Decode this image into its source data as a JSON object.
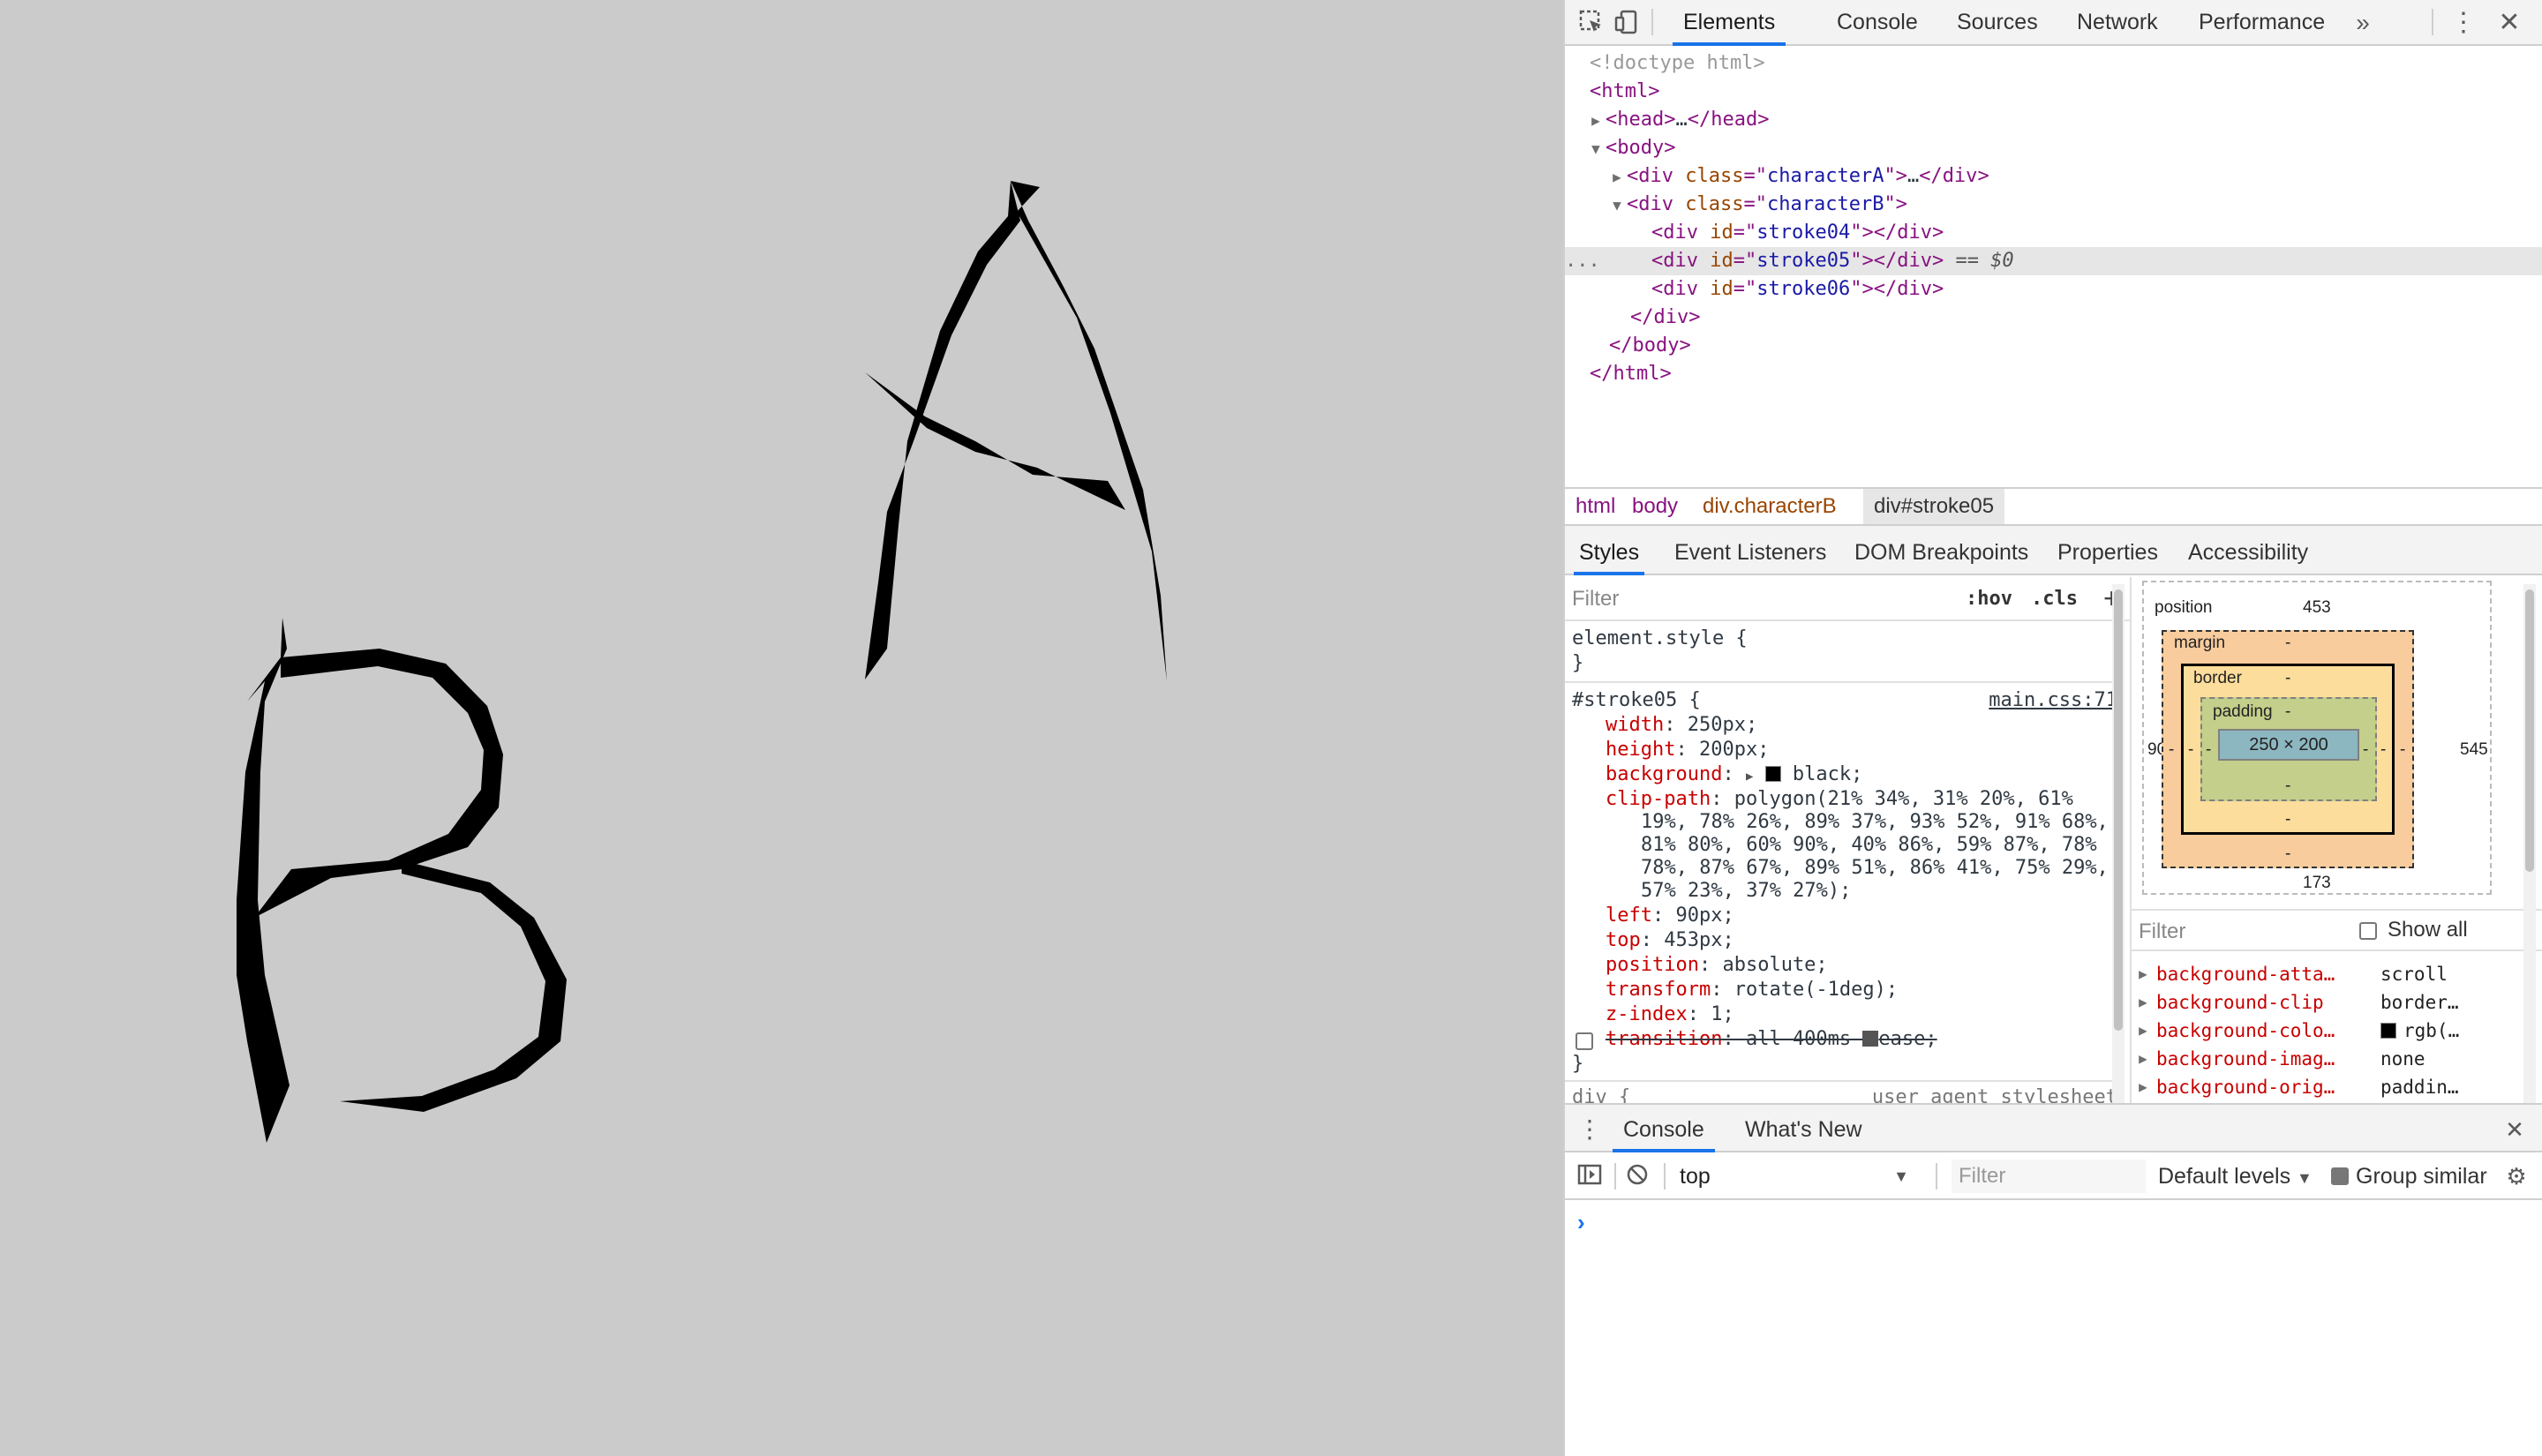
{
  "viewport": {
    "background": "#cbcbcb",
    "letters": [
      "A",
      "B"
    ]
  },
  "devtools": {
    "main_tabs": [
      "Elements",
      "Console",
      "Sources",
      "Network",
      "Performance"
    ],
    "more_tabs_icon": "chevrons-right-icon",
    "dom": {
      "doctype": "<!doctype html>",
      "html_open": "html",
      "head": "head",
      "head_ellipsis": "…",
      "body": "body",
      "div": "div",
      "class_attr": "class",
      "id_attr": "id",
      "character_a": "characterA",
      "character_b": "characterB",
      "stroke04": "stroke04",
      "stroke05": "stroke05",
      "stroke06": "stroke06",
      "selected_marker": "== $0",
      "row_menu": "..."
    },
    "breadcrumbs": [
      "html",
      "body",
      "div.characterB",
      "div#stroke05"
    ],
    "sub_tabs": [
      "Styles",
      "Event Listeners",
      "DOM Breakpoints",
      "Properties",
      "Accessibility"
    ],
    "styles": {
      "filter_placeholder": "Filter",
      "hov": ":hov",
      "cls": ".cls",
      "element_style": "element.style {",
      "close_brace": "}",
      "selector": "#stroke05 {",
      "source": "main.css:71",
      "props": [
        {
          "name": "width",
          "value": "250px;"
        },
        {
          "name": "height",
          "value": "200px;"
        },
        {
          "name": "background",
          "value": "black;"
        },
        {
          "name": "clip-path",
          "value": "polygon(21% 34%, 31% 20%, 61%"
        },
        {
          "name": "",
          "value": "19%, 78% 26%, 89% 37%, 93% 52%, 91% 68%,"
        },
        {
          "name": "",
          "value": "81% 80%, 60% 90%, 40% 86%, 59% 87%, 78%"
        },
        {
          "name": "",
          "value": "78%, 87% 67%, 89% 51%, 86% 41%, 75% 29%,"
        },
        {
          "name": "",
          "value": "57% 23%, 37% 27%);"
        },
        {
          "name": "left",
          "value": "90px;"
        },
        {
          "name": "top",
          "value": "453px;"
        },
        {
          "name": "position",
          "value": "absolute;"
        },
        {
          "name": "transform",
          "value": "rotate(-1deg);"
        },
        {
          "name": "z-index",
          "value": "1;"
        },
        {
          "name": "transition",
          "value": "all 400ms ",
          "extra": "ease;"
        }
      ],
      "next_rule": "div {",
      "next_source": "user agent stylesheet"
    },
    "box_model": {
      "position_label": "position",
      "position_top": "453",
      "position_left": "90",
      "position_right": "545",
      "position_bottom": "173",
      "margin_label": "margin",
      "border_label": "border",
      "padding_label": "padding",
      "dash": "-",
      "content": "250 × 200"
    },
    "computed": {
      "filter_placeholder": "Filter",
      "show_all": "Show all",
      "rows": [
        {
          "name": "background-atta…",
          "value": "scroll"
        },
        {
          "name": "background-clip",
          "value": "border…"
        },
        {
          "name": "background-colo…",
          "value": "rgb(…"
        },
        {
          "name": "background-imag…",
          "value": "none"
        },
        {
          "name": "background-orig…",
          "value": "paddin…"
        }
      ]
    },
    "drawer": {
      "tabs": [
        "Console",
        "What's New"
      ],
      "context": "top",
      "filter_placeholder": "Filter",
      "levels": "Default levels",
      "group_similar": "Group similar",
      "prompt": "›"
    }
  }
}
